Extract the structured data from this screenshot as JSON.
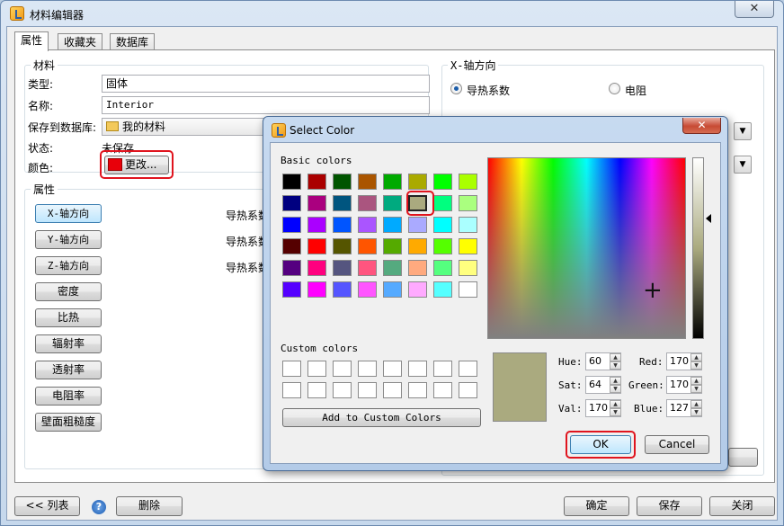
{
  "main_window": {
    "title": "材料编辑器",
    "close_glyph": "✕",
    "tabs": [
      "属性",
      "收藏夹",
      "数据库"
    ],
    "material_group": {
      "legend": "材料",
      "type_label": "类型:",
      "type_value": "固体",
      "name_label": "名称:",
      "name_value": "Interior",
      "save_db_label": "保存到数据库:",
      "save_db_value": "我的材料",
      "status_label": "状态:",
      "status_value": "未保存",
      "color_label": "颜色:",
      "color_button_label": "更改...",
      "color_value": "#e8000a"
    },
    "properties_group": {
      "legend": "属性",
      "buttons": [
        "X-轴方向",
        "Y-轴方向",
        "Z-轴方向",
        "密度",
        "比热",
        "辐射率",
        "透射率",
        "电阻率",
        "壁面粗糙度"
      ],
      "row_texts": [
        "导热系数",
        "导热系数",
        "导热系数"
      ]
    },
    "axis_group": {
      "legend": "X-轴方向",
      "radio_options": [
        "导热系数",
        "电阻"
      ],
      "selected_option": "导热系数"
    },
    "bottom_bar": {
      "list_button": "<< 列表",
      "help_icon": "?",
      "delete_button": "删除",
      "ok_button": "确定",
      "save_button": "保存",
      "close_button": "关闭"
    }
  },
  "color_dialog": {
    "title": "Select Color",
    "close_glyph": "✕",
    "basic_colors_label": "Basic colors",
    "basic_colors": [
      "#000000",
      "#aa0000",
      "#005500",
      "#aa5500",
      "#00aa00",
      "#aaaa00",
      "#00ff00",
      "#aaff00",
      "#000080",
      "#aa007f",
      "#00557f",
      "#aa557f",
      "#00aa7f",
      "#aaaa7f",
      "#00ff7f",
      "#aaff7f",
      "#0000ff",
      "#aa00ff",
      "#0055ff",
      "#aa55ff",
      "#00aaff",
      "#aaaaff",
      "#00ffff",
      "#aaffff",
      "#550000",
      "#ff0000",
      "#555500",
      "#ff5500",
      "#55aa00",
      "#ffaa00",
      "#55ff00",
      "#ffff00",
      "#550080",
      "#ff007f",
      "#55557f",
      "#ff557f",
      "#55aa7f",
      "#ffaa7f",
      "#55ff7f",
      "#ffff7f",
      "#5500ff",
      "#ff00ff",
      "#5555ff",
      "#ff55ff",
      "#55aaff",
      "#ffaaff",
      "#55ffff",
      "#ffffff"
    ],
    "selected_basic_index": 13,
    "custom_colors_label": "Custom colors",
    "custom_colors_count": 16,
    "add_custom_button": "Add to Custom Colors",
    "preview_color": "#aaaa7f",
    "crosshair_glyph": "+",
    "fields": {
      "hue_label": "Hue:",
      "hue": "60",
      "sat_label": "Sat:",
      "sat": "64",
      "val_label": "Val:",
      "val": "170",
      "red_label": "Red:",
      "red": "170",
      "green_label": "Green:",
      "green": "170",
      "blue_label": "Blue:",
      "blue": "127"
    },
    "ok_button": "OK",
    "cancel_button": "Cancel"
  },
  "background_fragments": {
    "partial_text_1": "导热系数",
    "partial_text_2": "数据"
  }
}
